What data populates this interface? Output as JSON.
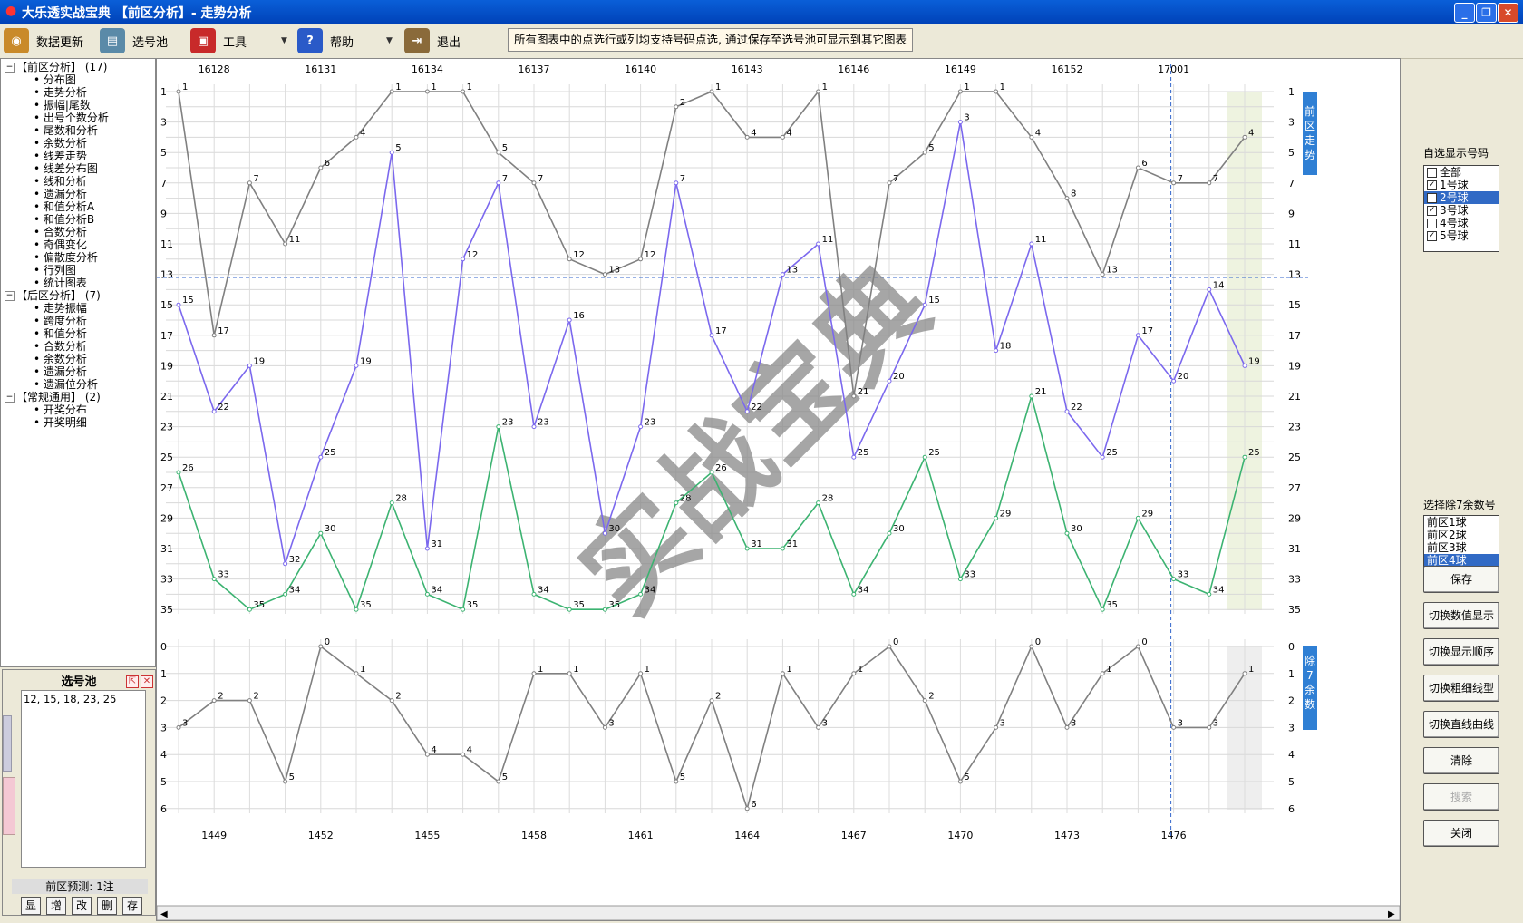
{
  "window": {
    "title": "大乐透实战宝典 【前区分析】- 走势分析",
    "minimize": "_",
    "restore": "❐",
    "close": "✕"
  },
  "toolbar": {
    "items": [
      {
        "label": "数据更新",
        "icon": "data-update-icon"
      },
      {
        "label": "选号池",
        "icon": "number-pool-icon"
      },
      {
        "label": "工具",
        "icon": "toolbox-icon"
      },
      {
        "label": "帮助",
        "icon": "help-book-icon"
      },
      {
        "label": "退出",
        "icon": "exit-door-icon"
      }
    ],
    "tip": "所有图表中的点选行或列均支持号码点选, 通过保存至选号池可显示到其它图表"
  },
  "tree": {
    "groups": [
      {
        "label": "【前区分析】",
        "count": "(17)",
        "items": [
          "分布图",
          "走势分析",
          "振幅|尾数",
          "出号个数分析",
          "尾数和分析",
          "余数分析",
          "线差走势",
          "线差分布图",
          "线和分析",
          "遗漏分析",
          "和值分析A",
          "和值分析B",
          "合数分析",
          "奇偶变化",
          "偏散度分析",
          "行列图",
          "统计图表"
        ]
      },
      {
        "label": "【后区分析】",
        "count": "(7)",
        "items": [
          "走势振幅",
          "跨度分析",
          "和值分析",
          "合数分析",
          "余数分析",
          "遗漏分析",
          "遗漏位分析"
        ]
      },
      {
        "label": "【常规通用】",
        "count": "(2)",
        "items": [
          "开奖分布",
          "开奖明细"
        ]
      }
    ]
  },
  "pool": {
    "title": "选号池",
    "content": "12, 15, 18, 23, 25",
    "predict": "前区预测: 1注",
    "buttons": [
      "显",
      "增",
      "改",
      "删",
      "存"
    ]
  },
  "right_panel": {
    "display_label": "自选显示号码",
    "display_options": [
      {
        "label": "全部",
        "checked": false,
        "selected": false
      },
      {
        "label": "1号球",
        "checked": true,
        "selected": false
      },
      {
        "label": "2号球",
        "checked": false,
        "selected": true
      },
      {
        "label": "3号球",
        "checked": true,
        "selected": false
      },
      {
        "label": "4号球",
        "checked": false,
        "selected": false
      },
      {
        "label": "5号球",
        "checked": true,
        "selected": false
      }
    ],
    "mod_label": "选择除7余数号",
    "mod_options": [
      {
        "label": "前区1球",
        "selected": false
      },
      {
        "label": "前区2球",
        "selected": false
      },
      {
        "label": "前区3球",
        "selected": false
      },
      {
        "label": "前区4球",
        "selected": true
      },
      {
        "label": "前区5球",
        "selected": false
      }
    ],
    "buttons": [
      {
        "label": "保存",
        "disabled": false
      },
      {
        "label": "切换数值显示",
        "disabled": false
      },
      {
        "label": "切换显示顺序",
        "disabled": false
      },
      {
        "label": "切换粗细线型",
        "disabled": false
      },
      {
        "label": "切换直线曲线",
        "disabled": false
      },
      {
        "label": "清除",
        "disabled": false
      },
      {
        "label": "搜索",
        "disabled": true
      },
      {
        "label": "关闭",
        "disabled": false
      }
    ]
  },
  "chart_data": [
    {
      "type": "line",
      "x_top_labels": [
        "16128",
        "16131",
        "16134",
        "16137",
        "16140",
        "16143",
        "16146",
        "16149",
        "16152",
        "17001"
      ],
      "ylim": [
        1,
        35
      ],
      "y_ticks": [
        1,
        3,
        5,
        7,
        9,
        11,
        13,
        15,
        17,
        19,
        21,
        23,
        25,
        27,
        29,
        31,
        33,
        35
      ],
      "side_label": "前区走势",
      "watermark": "实战宝典",
      "series": [
        {
          "color": "#808080",
          "values": [
            1,
            17,
            7,
            11,
            6,
            4,
            1,
            1,
            1,
            5,
            7,
            12,
            13,
            12,
            2,
            1,
            4,
            4,
            1,
            21,
            7,
            5,
            1,
            1,
            4,
            8,
            13,
            6,
            7,
            7,
            4
          ]
        },
        {
          "color": "#7b68ee",
          "values": [
            15,
            22,
            19,
            32,
            25,
            19,
            5,
            31,
            12,
            7,
            23,
            16,
            30,
            23,
            7,
            17,
            22,
            13,
            11,
            25,
            20,
            15,
            3,
            18,
            11,
            22,
            25,
            17,
            20,
            14,
            19
          ]
        },
        {
          "color": "#3cb371",
          "values": [
            26,
            33,
            35,
            34,
            30,
            35,
            28,
            34,
            35,
            23,
            34,
            35,
            35,
            34,
            28,
            26,
            31,
            31,
            28,
            34,
            30,
            25,
            33,
            29,
            21,
            30,
            35,
            29,
            33,
            34,
            25
          ]
        }
      ]
    },
    {
      "type": "line",
      "x_bottom_labels": [
        "1449",
        "1452",
        "1455",
        "1458",
        "1461",
        "1464",
        "1467",
        "1470",
        "1473",
        "1476"
      ],
      "ylim": [
        0,
        6
      ],
      "y_ticks": [
        0,
        1,
        2,
        3,
        4,
        5,
        6
      ],
      "side_label": "除7余数",
      "series": [
        {
          "color": "#808080",
          "values": [
            3,
            2,
            2,
            5,
            0,
            1,
            2,
            4,
            4,
            5,
            1,
            1,
            3,
            1,
            5,
            2,
            6,
            1,
            3,
            1,
            0,
            2,
            5,
            3,
            0,
            3,
            1,
            0,
            3,
            3,
            1
          ]
        }
      ]
    }
  ]
}
